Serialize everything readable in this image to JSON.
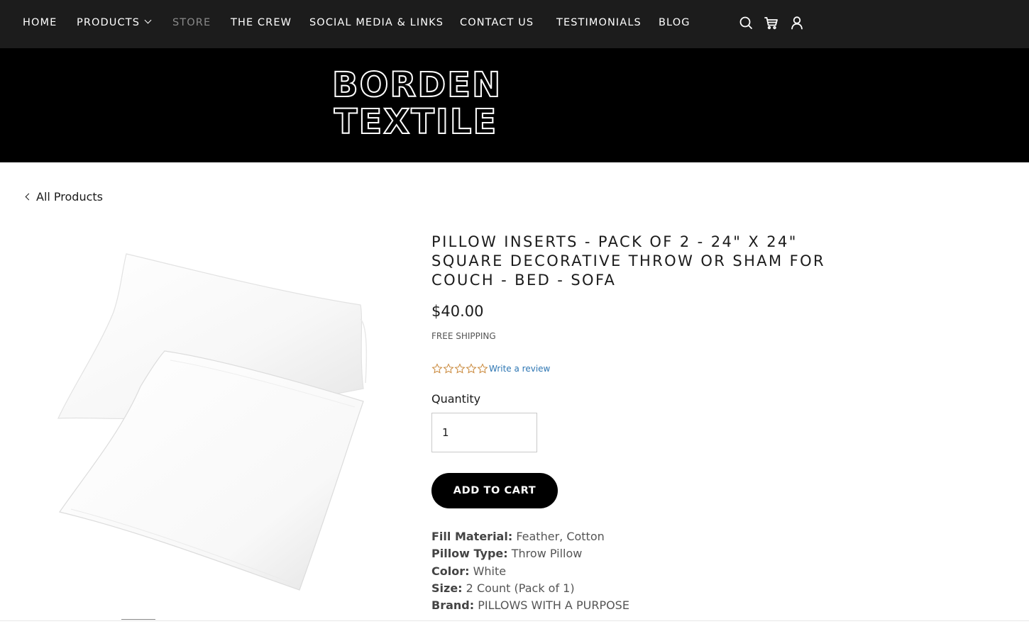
{
  "nav": {
    "items": [
      {
        "label": "HOME"
      },
      {
        "label": "PRODUCTS"
      },
      {
        "label": "STORE"
      },
      {
        "label": "THE CREW"
      },
      {
        "label": "SOCIAL MEDIA & LINKS"
      },
      {
        "label": "CONTACT US"
      },
      {
        "label": "TESTIMONIALS"
      },
      {
        "label": "BLOG"
      }
    ],
    "active": "STORE",
    "icons": [
      "search-icon",
      "cart-icon",
      "account-icon"
    ]
  },
  "logo": {
    "line1": "BORDEN",
    "line2": "TEXTILE"
  },
  "back_link": "All Products",
  "product": {
    "title": "PILLOW INSERTS - PACK OF 2 - 24\" X 24\" SQUARE DECORATIVE THROW OR SHAM FOR COUCH - BED - SOFA",
    "price": "$40.00",
    "shipping": "FREE SHIPPING",
    "rating": 0,
    "rating_max": 5,
    "review_link": "Write a review",
    "quantity_label": "Quantity",
    "quantity_value": "1",
    "add_to_cart": "ADD TO CART",
    "specs": [
      {
        "key": "Fill Material:",
        "value": "Feather, Cotton"
      },
      {
        "key": "Pillow Type:",
        "value": "Throw Pillow"
      },
      {
        "key": "Color:",
        "value": "White"
      },
      {
        "key": "Size:",
        "value": "2 Count (Pack of 1)"
      },
      {
        "key": "Brand:",
        "value": "PILLOWS WITH A PURPOSE"
      }
    ]
  },
  "colors": {
    "nav_bg": "#1c1c1c",
    "hero_bg": "#000000",
    "star_color": "#c9883a",
    "link_color": "#2d76b3",
    "button_bg": "#000000"
  }
}
